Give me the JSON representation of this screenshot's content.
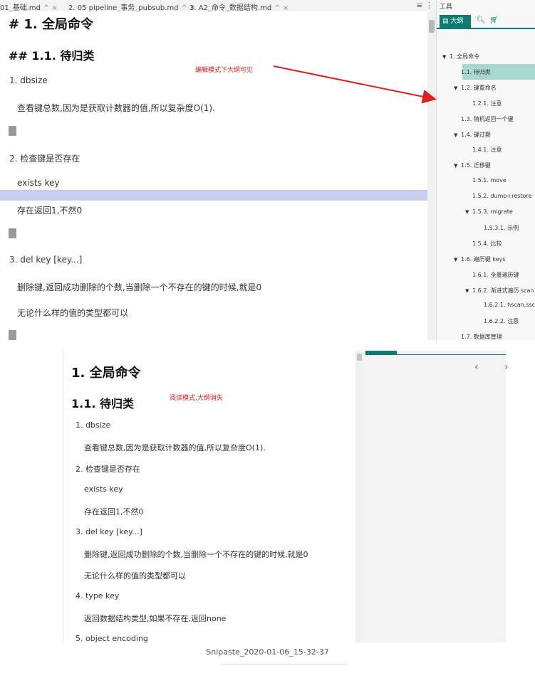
{
  "editor": {
    "tabs": [
      {
        "label": "01_基础.md",
        "close": "^ ×"
      },
      {
        "label": "2. 05 pipeline_事务_pubsub.md",
        "close": "^ ×"
      },
      {
        "label": "3. A2_命令_数据结构.md",
        "close": "^ ×"
      }
    ],
    "tab_menu": "≡ ⋮",
    "h1": "# 1. 全局命令",
    "h2": "## 1.1. 待归类",
    "items": [
      {
        "num": "1.",
        "text": "dbsize"
      },
      {
        "num": "2.",
        "text": "检查键是否存在"
      },
      {
        "num": "3.",
        "text": "del key [key...]"
      }
    ],
    "paragraphs": [
      "查看键总数,因为是获取计数器的值,所以复杂度O(1).",
      "exists key",
      "存在返回1,不然0",
      "删除键,返回成功删除的个数,当删除一个不存在的键的时候,就是0",
      "无论什么样的值的类型都可以"
    ],
    "annotation": "编辑模式下大纲可见"
  },
  "sidebar": {
    "title": "工具",
    "tab_active": "大纲",
    "outline": [
      {
        "label": "1. 全局命令",
        "level": 0,
        "arrow": true
      },
      {
        "label": "1.1. 待归类",
        "level": 1,
        "arrow": false,
        "active": true
      },
      {
        "label": "1.2. 键重命名",
        "level": 1,
        "arrow": true
      },
      {
        "label": "1.2.1. 注意",
        "level": 2,
        "arrow": false
      },
      {
        "label": "1.3. 随机返回一个键",
        "level": 1,
        "arrow": false
      },
      {
        "label": "1.4. 键过期",
        "level": 1,
        "arrow": true
      },
      {
        "label": "1.4.1. 注意",
        "level": 2,
        "arrow": false
      },
      {
        "label": "1.5. 迁移键",
        "level": 1,
        "arrow": true
      },
      {
        "label": "1.5.1. move",
        "level": 2,
        "arrow": false
      },
      {
        "label": "1.5.2. dump+restore",
        "level": 2,
        "arrow": false
      },
      {
        "label": "1.5.3. migrate",
        "level": 2,
        "arrow": true
      },
      {
        "label": "1.5.3.1. 示例",
        "level": 3,
        "arrow": false
      },
      {
        "label": "1.5.4. 比较",
        "level": 2,
        "arrow": false
      },
      {
        "label": "1.6. 遍历键 keys",
        "level": 1,
        "arrow": true
      },
      {
        "label": "1.6.1. 全量遍历键",
        "level": 2,
        "arrow": false
      },
      {
        "label": "1.6.2. 渐进式遍历 scan",
        "level": 2,
        "arrow": true
      },
      {
        "label": "1.6.2.1. hscan,sscan",
        "level": 3,
        "arrow": false
      },
      {
        "label": "1.6.2.2. 注意",
        "level": 3,
        "arrow": false
      },
      {
        "label": "1.7. 数据库管理",
        "level": 1,
        "arrow": false
      }
    ]
  },
  "reader": {
    "h1": "1. 全局命令",
    "h2": "1.1. 待归类",
    "annotation": "阅读模式,大纲消失",
    "items": [
      {
        "text": "1. dbsize",
        "sub": "查看键总数,因为是获取计数器的值,所以复杂度O(1)."
      },
      {
        "text": "2. 检查键是否存在",
        "sub": "exists key"
      },
      {
        "text": "",
        "sub": "存在返回1,不然0"
      },
      {
        "text": "3. del key [key...]",
        "sub": "删除键,返回成功删除的个数,当删除一个不存在的键的时候,就是0"
      },
      {
        "text": "",
        "sub": "无论什么样的值的类型都可以"
      },
      {
        "text": "4. type key",
        "sub": "返回数据结构类型,如果不存在,返回none"
      },
      {
        "text": "5. object encoding",
        "sub": ""
      }
    ],
    "nav": "‹ ›"
  },
  "caption": "Snipaste_2020-01-06_15-32-37",
  "colors": {
    "accent": "#0f7c73",
    "annotation": "#e0201e",
    "highlight": "#c9cdef"
  }
}
